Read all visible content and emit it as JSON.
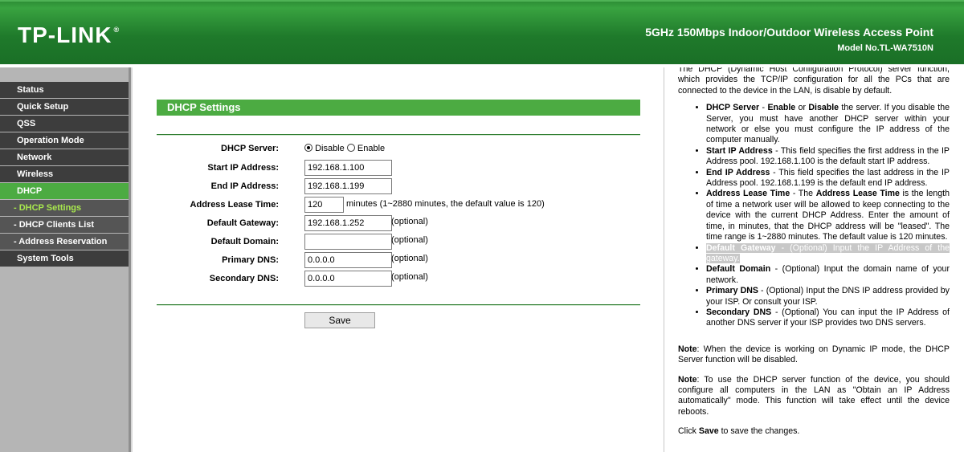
{
  "header": {
    "logo": "TP-LINK",
    "logo_reg": "®",
    "product": "5GHz 150Mbps Indoor/Outdoor Wireless Access Point",
    "model": "Model No.TL-WA7510N"
  },
  "sidebar": {
    "items": [
      {
        "label": "Status"
      },
      {
        "label": "Quick Setup"
      },
      {
        "label": "QSS"
      },
      {
        "label": "Operation Mode"
      },
      {
        "label": "Network"
      },
      {
        "label": "Wireless"
      },
      {
        "label": "DHCP"
      },
      {
        "label": "- DHCP Settings"
      },
      {
        "label": "- DHCP Clients List"
      },
      {
        "label": "- Address Reservation"
      },
      {
        "label": "System Tools"
      }
    ]
  },
  "main": {
    "title": "DHCP Settings",
    "dhcp_server_label": "DHCP Server:",
    "disable_label": "Disable",
    "enable_label": "Enable",
    "dhcp_server_value": "Disable",
    "start_ip_label": "Start IP Address:",
    "start_ip": "192.168.1.100",
    "end_ip_label": "End IP Address:",
    "end_ip": "192.168.1.199",
    "lease_label": "Address Lease Time:",
    "lease": "120",
    "lease_hint": "minutes (1~2880 minutes, the default value is 120)",
    "gateway_label": "Default Gateway:",
    "gateway": "192.168.1.252",
    "domain_label": "Default Domain:",
    "domain": "",
    "primary_dns_label": "Primary DNS:",
    "primary_dns": "0.0.0.0",
    "secondary_dns_label": "Secondary DNS:",
    "secondary_dns": "0.0.0.0",
    "optional": "(optional)",
    "save_label": "Save"
  },
  "help": {
    "intro": "The DHCP (Dynamic Host Configuration Protocol) server function, which provides the TCP/IP configuration for all the PCs that are connected to the device in the LAN, is disable by default.",
    "b1_term": "DHCP Server",
    "b1_enable": "Enable",
    "b1_or": " or ",
    "b1_disable": "Disable",
    "b1_text": " the server. If you disable the Server, you must have another DHCP server within your network or else you must configure the IP address of the computer manually.",
    "b2_term": "Start IP Address",
    "b2_text": " - This field specifies the first address in the IP Address pool. 192.168.1.100 is the default start IP address.",
    "b3_term": "End IP Address",
    "b3_text": " - This field specifies the last address in the IP Address pool. 192.168.1.199 is the default end IP address.",
    "b4_term": "Address Lease Time",
    "b4_text1": " - The ",
    "b4_term2": "Address Lease Time",
    "b4_text2": " is the length of time a network user will be allowed to keep connecting to the device with the current DHCP Address. Enter the amount of time, in minutes, that the DHCP address will be \"leased\". The time range is 1~2880 minutes. The default value is 120 minutes.",
    "b5_term": "Default Gateway",
    "b5_text": " - (Optional) Input the IP Address of the gateway.",
    "b6_term": "Default Domain",
    "b6_text": " - (Optional) Input the domain name of your network.",
    "b7_term": "Primary DNS",
    "b7_text": " - (Optional) Input the DNS IP address provided by your ISP. Or consult your ISP.",
    "b8_term": "Secondary DNS",
    "b8_text": " - (Optional) You can input the IP Address of another DNS server if your ISP provides two DNS servers.",
    "note_label": "Note",
    "note1": ": When the device is working on Dynamic IP mode, the DHCP Server function will be disabled.",
    "note2": ": To use the DHCP server function of the device, you should configure all computers in the LAN as \"Obtain an IP Address automatically\" mode. This function will take effect until the device reboots.",
    "click_prefix": "Click ",
    "click_save": "Save",
    "click_suffix": " to save the changes."
  }
}
